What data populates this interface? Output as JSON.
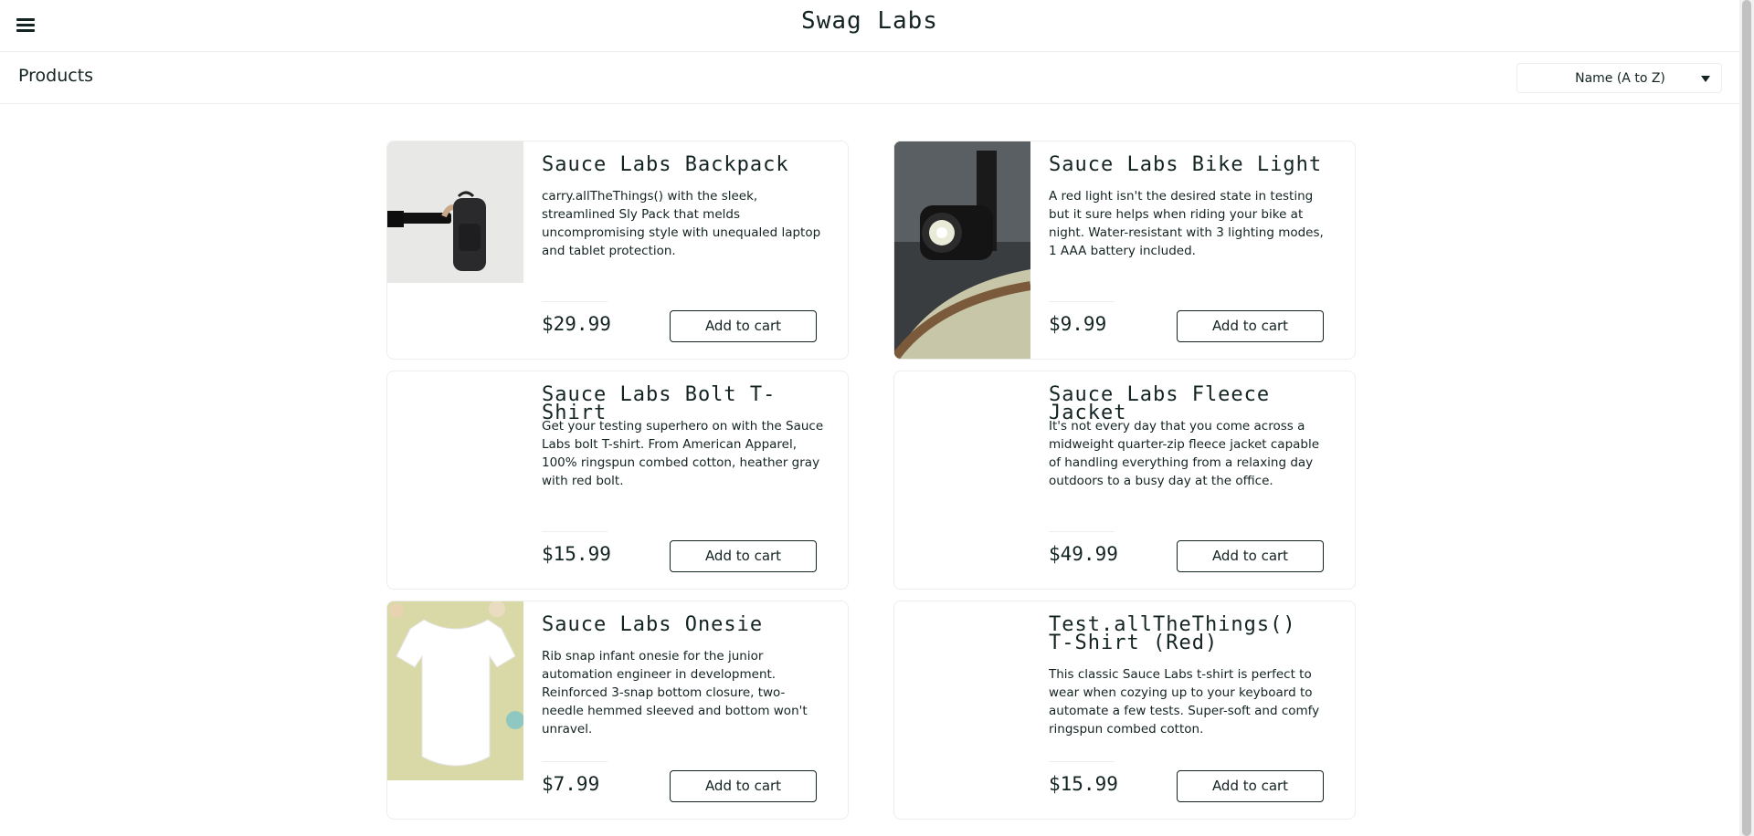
{
  "header": {
    "menu_icon": "hamburger-menu-icon",
    "logo": "Swag Labs"
  },
  "subheader": {
    "title": "Products",
    "sort": {
      "selected": "Name (A to Z)",
      "icon": "caret-down-icon"
    }
  },
  "products": [
    {
      "name": "Sauce Labs Backpack",
      "description": "carry.allTheThings() with the sleek, streamlined Sly Pack that melds uncompromising style with unequaled laptop and tablet protection.",
      "price": "$29.99",
      "button": "Add to cart"
    },
    {
      "name": "Sauce Labs Bike Light",
      "description": "A red light isn't the desired state in testing but it sure helps when riding your bike at night. Water-resistant with 3 lighting modes, 1 AAA battery included.",
      "price": "$9.99",
      "button": "Add to cart"
    },
    {
      "name": "Sauce Labs Bolt T-Shirt",
      "description": "Get your testing superhero on with the Sauce Labs bolt T-shirt. From American Apparel, 100% ringspun combed cotton, heather gray with red bolt.",
      "price": "$15.99",
      "button": "Add to cart"
    },
    {
      "name": "Sauce Labs Fleece Jacket",
      "description": "It's not every day that you come across a midweight quarter-zip fleece jacket capable of handling everything from a relaxing day outdoors to a busy day at the office.",
      "price": "$49.99",
      "button": "Add to cart"
    },
    {
      "name": "Sauce Labs Onesie",
      "description": "Rib snap infant onesie for the junior automation engineer in development. Reinforced 3-snap bottom closure, two-needle hemmed sleeved and bottom won't unravel.",
      "price": "$7.99",
      "button": "Add to cart"
    },
    {
      "name": "Test.allTheThings() T-Shirt (Red)",
      "description": "This classic Sauce Labs t-shirt is perfect to wear when cozying up to your keyboard to automate a few tests. Super-soft and comfy ringspun combed cotton.",
      "price": "$15.99",
      "button": "Add to cart"
    }
  ]
}
